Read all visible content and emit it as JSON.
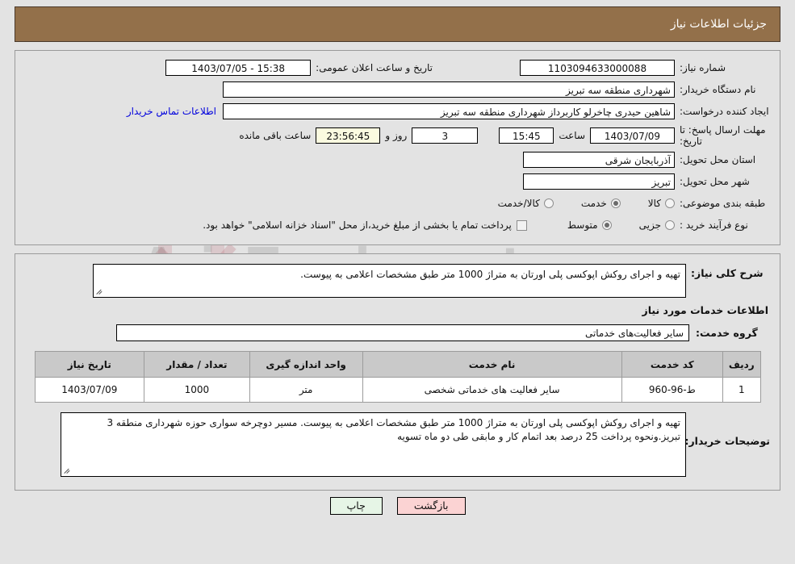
{
  "header": {
    "title": "جزئیات اطلاعات نیاز"
  },
  "colors": {
    "header_bg": "#93704a",
    "header_text": "#ffffff",
    "page_bg": "#e3e3e3",
    "link": "#0000dd",
    "counter_bg": "#fbfbe0",
    "table_header_bg": "#c9c9c9",
    "btn_print_bg": "#e6f5e6",
    "btn_back_bg": "#fbd3d3"
  },
  "watermark": {
    "text": "AriaTender.net"
  },
  "top_form": {
    "need_number": {
      "label": "شماره نیاز:",
      "value": "1103094633000088"
    },
    "announce_datetime": {
      "label": "تاریخ و ساعت اعلان عمومی:",
      "value": "15:38 - 1403/07/05"
    },
    "buyer_org": {
      "label": "نام دستگاه خریدار:",
      "value": "شهرداری منطقه سه تبریز"
    },
    "request_creator": {
      "label": "ایجاد کننده درخواست:",
      "value": "شاهین حیدری چاخرلو کاربرداز شهرداری منطقه سه تبریز"
    },
    "contact_link": {
      "label": "اطلاعات تماس خریدار"
    },
    "deadline": {
      "label": "مهلت ارسال پاسخ: تا تاریخ:",
      "date": "1403/07/09",
      "time_label": "ساعت",
      "time": "15:45",
      "days": "3",
      "days_label": "روز و",
      "counter": "23:56:45",
      "counter_label": "ساعت باقی مانده"
    },
    "province": {
      "label": "استان محل تحویل:",
      "value": "آذربایجان شرقی"
    },
    "city": {
      "label": "شهر محل تحویل:",
      "value": "تبریز"
    },
    "category": {
      "label": "طبقه بندی موضوعی:",
      "options": [
        {
          "label": "کالا",
          "checked": false
        },
        {
          "label": "خدمت",
          "checked": true
        },
        {
          "label": "کالا/خدمت",
          "checked": false
        }
      ]
    },
    "process_type": {
      "label": "نوع فرآیند خرید :",
      "options": [
        {
          "label": "جزیی",
          "checked": false
        },
        {
          "label": "متوسط",
          "checked": true
        }
      ],
      "checkbox": {
        "checked": false,
        "text": "پرداخت تمام یا بخشی از مبلغ خرید،از محل \"اسناد خزانه اسلامی\" خواهد بود."
      }
    }
  },
  "bottom_section": {
    "need_description": {
      "label": "شرح کلی نیاز:",
      "value": "تهیه و اجرای روکش اپوکسی پلی اورتان به متراژ 1000 متر طبق مشخصات اعلامی به پیوست."
    },
    "services_title": "اطلاعات خدمات مورد نیاز",
    "service_group": {
      "label": "گروه خدمت:",
      "value": "سایر فعالیت‌های خدماتی"
    },
    "table": {
      "columns": [
        "ردیف",
        "کد خدمت",
        "نام خدمت",
        "واحد اندازه گیری",
        "تعداد / مقدار",
        "تاریخ نیاز"
      ],
      "rows": [
        {
          "radif": "1",
          "code": "ط-96-960",
          "name": "سایر فعالیت های خدماتی شخصی",
          "unit": "متر",
          "qty": "1000",
          "date": "1403/07/09"
        }
      ]
    },
    "buyer_notes": {
      "label": "توضیحات خریدار:",
      "value": "تهیه و اجرای روکش اپوکسی پلی اورتان به متراژ 1000 متر طبق مشخصات اعلامی به پیوست. مسیر دوچرخه سواری حوزه شهرداری منطقه 3 تبریز.ونحوه پرداخت 25 درصد بعد اتمام کار و مابقی طی دو ماه تسویه"
    }
  },
  "footer": {
    "print_label": "چاپ",
    "back_label": "بازگشت"
  }
}
